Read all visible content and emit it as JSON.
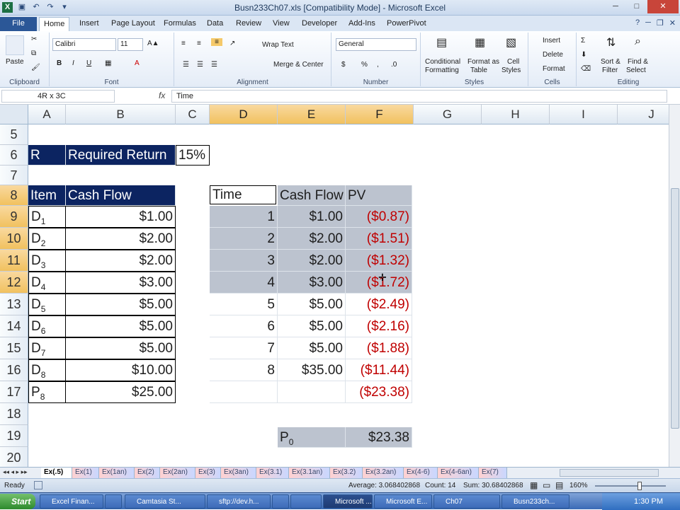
{
  "window": {
    "title": "Busn233Ch07.xls  [Compatibility Mode]  -  Microsoft Excel"
  },
  "tabs": [
    "File",
    "Home",
    "Insert",
    "Page Layout",
    "Formulas",
    "Data",
    "Review",
    "View",
    "Developer",
    "Add-Ins",
    "PowerPivot"
  ],
  "ribbon": {
    "clipboard": {
      "label": "Clipboard",
      "paste": "Paste"
    },
    "font": {
      "label": "Font",
      "name": "Calibri",
      "size": "11",
      "bold": "B",
      "italic": "I",
      "underline": "U"
    },
    "alignment": {
      "label": "Alignment",
      "wrap": "Wrap Text",
      "merge": "Merge & Center"
    },
    "number": {
      "label": "Number",
      "format": "General",
      "currency": "$",
      "percent": "%"
    },
    "styles": {
      "label": "Styles",
      "cond1": "Conditional",
      "cond2": "Formatting",
      "fmt1": "Format as",
      "fmt2": "Table",
      "cell1": "Cell",
      "cell2": "Styles"
    },
    "cells": {
      "label": "Cells",
      "insert": "Insert",
      "delete": "Delete",
      "format": "Format"
    },
    "editing": {
      "label": "Editing",
      "sort1": "Sort &",
      "sort2": "Filter",
      "find1": "Find &",
      "find2": "Select"
    }
  },
  "formula_bar": {
    "name_box": "4R x 3C",
    "fx": "fx",
    "content": "Time"
  },
  "columns": [
    "A",
    "B",
    "C",
    "D",
    "E",
    "F",
    "G",
    "H",
    "I",
    "J"
  ],
  "rows": [
    "5",
    "6",
    "7",
    "8",
    "9",
    "10",
    "11",
    "12",
    "13",
    "14",
    "15",
    "16",
    "17",
    "18",
    "19",
    "20"
  ],
  "sheet": {
    "r6": {
      "a": "R",
      "b": "Required Return",
      "c": "15%"
    },
    "r8": {
      "a": "Item",
      "b": "Cash Flow",
      "d": "Time",
      "e": "Cash Flow",
      "f": "PV"
    },
    "items": [
      {
        "d": "D",
        "sub": "1",
        "cf": "$1.00",
        "t": "1",
        "cf2": "$1.00",
        "pv": "($0.87)"
      },
      {
        "d": "D",
        "sub": "2",
        "cf": "$2.00",
        "t": "2",
        "cf2": "$2.00",
        "pv": "($1.51)"
      },
      {
        "d": "D",
        "sub": "3",
        "cf": "$2.00",
        "t": "3",
        "cf2": "$2.00",
        "pv": "($1.32)"
      },
      {
        "d": "D",
        "sub": "4",
        "cf": "$3.00",
        "t": "4",
        "cf2": "$3.00",
        "pv": "($1.72)"
      },
      {
        "d": "D",
        "sub": "5",
        "cf": "$5.00",
        "t": "5",
        "cf2": "$5.00",
        "pv": "($2.49)"
      },
      {
        "d": "D",
        "sub": "6",
        "cf": "$5.00",
        "t": "6",
        "cf2": "$5.00",
        "pv": "($2.16)"
      },
      {
        "d": "D",
        "sub": "7",
        "cf": "$5.00",
        "t": "7",
        "cf2": "$5.00",
        "pv": "($1.88)"
      },
      {
        "d": "D",
        "sub": "8",
        "cf": "$10.00",
        "t": "8",
        "cf2": "$35.00",
        "pv": "($11.44)"
      },
      {
        "d": "P",
        "sub": "8",
        "cf": "$25.00",
        "t": "",
        "cf2": "",
        "pv": "($23.38)"
      }
    ],
    "r19": {
      "e": "P",
      "esub": "0",
      "f": "$23.38"
    }
  },
  "sheet_tabs": [
    "Ex(.5)",
    "Ex(1)",
    "Ex(1an)",
    "Ex(2)",
    "Ex(2an)",
    "Ex(3)",
    "Ex(3an)",
    "Ex(3.1)",
    "Ex(3.1an)",
    "Ex(3.2)",
    "Ex(3.2an)",
    "Ex(4-6)",
    "Ex(4-6an)",
    "Ex(7)"
  ],
  "status": {
    "ready": "Ready",
    "average": "Average: 3.068402868",
    "count": "Count: 14",
    "sum": "Sum: 30.68402868",
    "zoom": "160%"
  },
  "taskbar": {
    "start": "Start",
    "items": [
      "Excel Finan...",
      "",
      "Camtasia St...",
      "sftp://dev.h...",
      "",
      "",
      "Microsoft ...",
      "Microsoft E...",
      "Ch07",
      "Busn233ch..."
    ],
    "time": "1:30 PM"
  },
  "colors": {
    "navy": "#0c2461",
    "gray_fill": "#bcc3cf",
    "negative": "#c00000",
    "selected_header": "#f1c15f"
  }
}
